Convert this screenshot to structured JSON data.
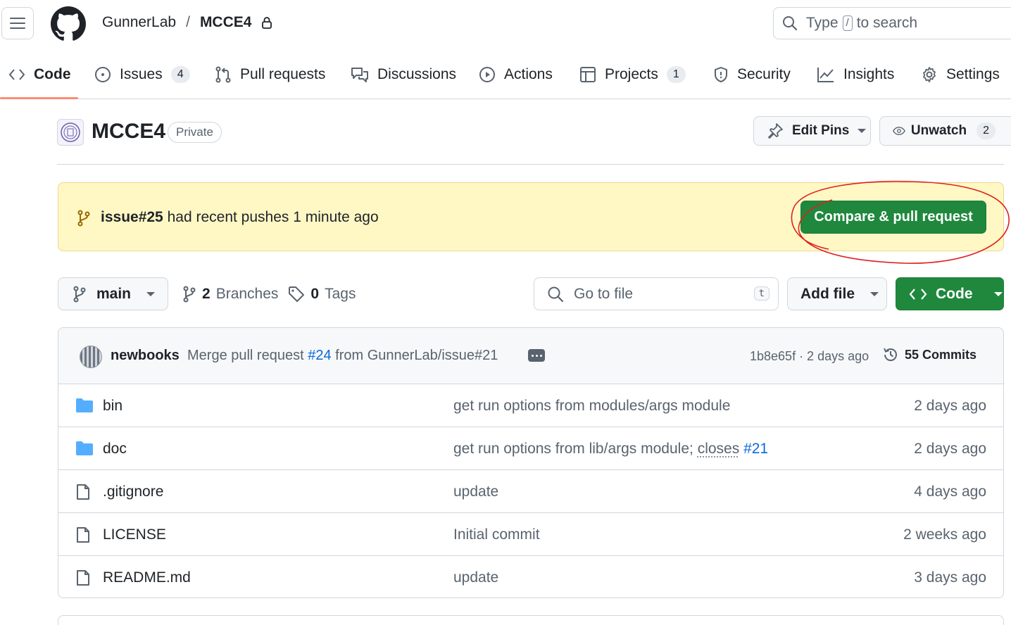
{
  "header": {
    "owner": "GunnerLab",
    "separator": "/",
    "repo": "MCCE4",
    "search_prefix": "Type",
    "search_key": "/",
    "search_suffix": "to search"
  },
  "nav": {
    "tabs": [
      {
        "label": "Code",
        "icon": "code-icon"
      },
      {
        "label": "Issues",
        "icon": "issue-icon",
        "count": "4"
      },
      {
        "label": "Pull requests",
        "icon": "pull-request-icon"
      },
      {
        "label": "Discussions",
        "icon": "discussion-icon"
      },
      {
        "label": "Actions",
        "icon": "play-icon"
      },
      {
        "label": "Projects",
        "icon": "table-icon",
        "count": "1"
      },
      {
        "label": "Security",
        "icon": "shield-icon"
      },
      {
        "label": "Insights",
        "icon": "graph-icon"
      },
      {
        "label": "Settings",
        "icon": "gear-icon"
      }
    ],
    "active_tab": "Code"
  },
  "repo_header": {
    "name": "MCCE4",
    "visibility": "Private",
    "edit_pins_label": "Edit Pins",
    "unwatch_label": "Unwatch",
    "watch_count": "2"
  },
  "banner": {
    "branch": "issue#25",
    "text": "had recent pushes 1 minute ago",
    "button_label": "Compare & pull request",
    "annotation_color": "#e02020"
  },
  "branch_bar": {
    "current_branch": "main",
    "branches_count": "2",
    "branches_label": "Branches",
    "tags_count": "0",
    "tags_label": "Tags",
    "goto_placeholder": "Go to file",
    "goto_shortcut": "t",
    "add_file_label": "Add file",
    "code_label": "Code"
  },
  "latest_commit": {
    "author": "newbooks",
    "message_prefix": "Merge pull request",
    "pr_link": "#24",
    "message_suffix": "from GunnerLab/issue#21",
    "sha_time": "1b8e65f · 2 days ago",
    "commits_count": "55 Commits"
  },
  "files": [
    {
      "name": "bin",
      "type": "folder",
      "message": "get run options from modules/args module",
      "date": "2 days ago"
    },
    {
      "name": "doc",
      "type": "folder",
      "message_plain": "get run options from lib/args module;",
      "message_underlined": "closes",
      "message_link": "#21",
      "date": "2 days ago"
    },
    {
      "name": ".gitignore",
      "type": "file",
      "message": "update",
      "date": "4 days ago"
    },
    {
      "name": "LICENSE",
      "type": "file",
      "message": "Initial commit",
      "date": "2 weeks ago"
    },
    {
      "name": "README.md",
      "type": "file",
      "message": "update",
      "date": "3 days ago"
    }
  ],
  "colors": {
    "accent_green": "#1f883d",
    "link_blue": "#0969da",
    "banner_bg": "#fff8c5",
    "tab_underline": "#fd8c73",
    "folder_blue": "#54aeff"
  }
}
